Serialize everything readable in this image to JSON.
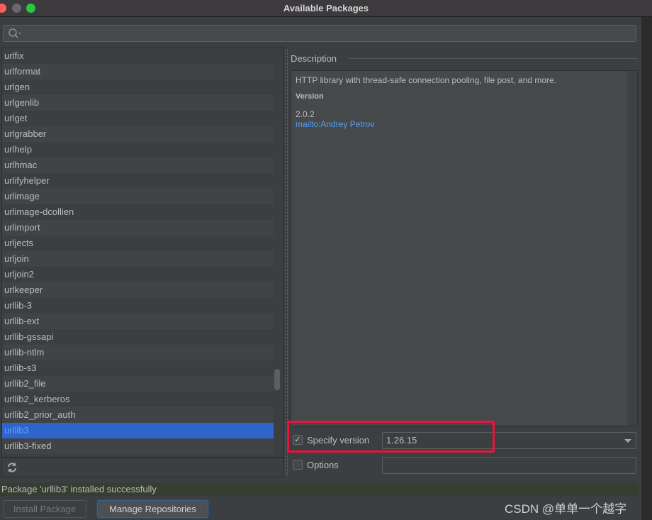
{
  "window": {
    "title": "Available Packages"
  },
  "search": {
    "placeholder": ""
  },
  "packages": [
    "urlfix",
    "urlformat",
    "urlgen",
    "urlgenlib",
    "urlget",
    "urlgrabber",
    "urlhelp",
    "urlhmac",
    "urlifyhelper",
    "urlimage",
    "urlimage-dcollien",
    "urlimport",
    "urljects",
    "urljoin",
    "urljoin2",
    "urlkeeper",
    "urllib-3",
    "urllib-ext",
    "urllib-gssapi",
    "urllib-ntlm",
    "urllib-s3",
    "urllib2_file",
    "urllib2_kerberos",
    "urllib2_prior_auth",
    "urllib3",
    "urllib3-fixed"
  ],
  "selected_package": "urllib3",
  "description": {
    "label": "Description",
    "summary": "HTTP library with thread-safe connection pooling, file post, and more.",
    "version_heading": "Version",
    "version": "2.0.2",
    "author_link": "mailto:Andrey Petrov"
  },
  "specify_version": {
    "label": "Specify version",
    "checked": true,
    "value": "1.26.15"
  },
  "options": {
    "label": "Options",
    "checked": false,
    "value": ""
  },
  "status": "Package 'urllib3' installed successfully",
  "buttons": {
    "install": "Install Package",
    "manage": "Manage Repositories"
  },
  "watermark": "CSDN @单单一个越字",
  "colors": {
    "selection": "#2f65ca",
    "link": "#589df6",
    "highlight": "#f0103a",
    "status_bg": "#353e31"
  }
}
